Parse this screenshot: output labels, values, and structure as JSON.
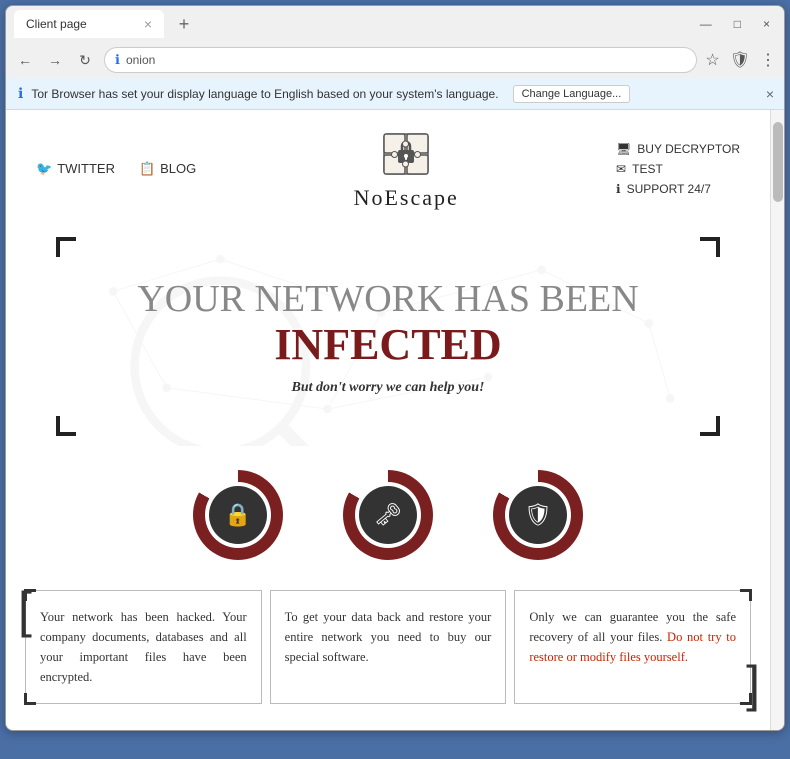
{
  "browser": {
    "tab_title": "Client page",
    "close_label": "×",
    "new_tab_label": "+",
    "minimize": "—",
    "maximize": "□",
    "close_window": "×",
    "address": "onion",
    "address_full": "http://noescape.onion/page/noescape/index.html",
    "back_icon": "←",
    "forward_icon": "→",
    "refresh_icon": "↻",
    "star_icon": "☆",
    "shield_icon": "🛡",
    "settings_icon": "⋮"
  },
  "tor_bar": {
    "message": "Tor Browser has set your display language to English based on your system's language.",
    "change_button": "Change Language...",
    "close": "×"
  },
  "site": {
    "nav": {
      "twitter_label": "TWITTER",
      "blog_label": "BLOG",
      "buy_decryptor_label": "BUY DECRYPTOR",
      "test_label": "TEST",
      "support_label": "SUPPORT 24/7",
      "logo_title": "NoEscape"
    },
    "hero": {
      "line1": "Your network has been",
      "line2": "INFECTED",
      "subtitle": "But don't worry we can help you!"
    },
    "icons": [
      {
        "symbol": "🔒",
        "label": "lock"
      },
      {
        "symbol": "🔑",
        "label": "key"
      },
      {
        "symbol": "🛡",
        "label": "shield"
      }
    ],
    "cards": [
      {
        "text": "Your network has been hacked. Your company documents, databases and all your important files have been encrypted."
      },
      {
        "text": "To get your data back and restore your entire network you need to buy our special software."
      },
      {
        "text_before": "Only we can guarantee you the safe recovery of all your files.",
        "text_red": " Do not try to restore or modify files yourself.",
        "text_after": ""
      }
    ]
  }
}
